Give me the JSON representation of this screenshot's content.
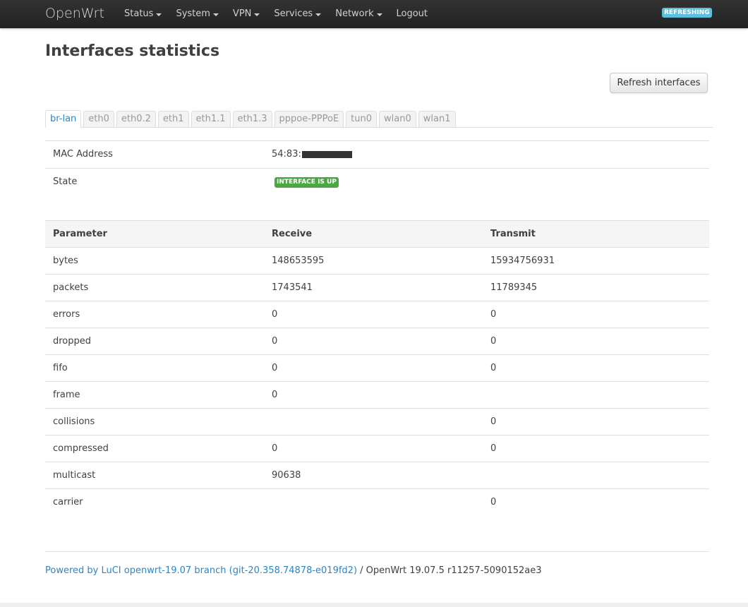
{
  "header": {
    "brand": "OpenWrt",
    "nav": [
      {
        "label": "Status",
        "dropdown": true
      },
      {
        "label": "System",
        "dropdown": true
      },
      {
        "label": "VPN",
        "dropdown": true
      },
      {
        "label": "Services",
        "dropdown": true
      },
      {
        "label": "Network",
        "dropdown": true
      },
      {
        "label": "Logout",
        "dropdown": false
      }
    ],
    "indicator": "REFRESHING"
  },
  "page": {
    "title": "Interfaces statistics",
    "refresh_button": "Refresh interfaces"
  },
  "tabs": [
    "br-lan",
    "eth0",
    "eth0.2",
    "eth1",
    "eth1.1",
    "eth1.3",
    "pppoe-PPPoE",
    "tun0",
    "wlan0",
    "wlan1"
  ],
  "active_tab": "br-lan",
  "info": {
    "mac_label": "MAC Address",
    "mac_value": "54:83:",
    "state_label": "State",
    "state_value": "INTERFACE IS UP"
  },
  "stats": {
    "headers": [
      "Parameter",
      "Receive",
      "Transmit"
    ],
    "rows": [
      [
        "bytes",
        "148653595",
        "15934756931"
      ],
      [
        "packets",
        "1743541",
        "11789345"
      ],
      [
        "errors",
        "0",
        "0"
      ],
      [
        "dropped",
        "0",
        "0"
      ],
      [
        "fifo",
        "0",
        "0"
      ],
      [
        "frame",
        "0",
        ""
      ],
      [
        "collisions",
        "",
        "0"
      ],
      [
        "compressed",
        "0",
        "0"
      ],
      [
        "multicast",
        "90638",
        ""
      ],
      [
        "carrier",
        "",
        "0"
      ]
    ]
  },
  "footer": {
    "link_text": "Powered by LuCI openwrt-19.07 branch (git-20.358.74878-e019fd2)",
    "suffix": " / OpenWrt 19.07.5 r11257-5090152ae3"
  },
  "colors": {
    "link": "#2c86c9",
    "badge_up": "#4aa842",
    "refreshing": "#5bc0de",
    "navbar": "#2a2a2a"
  }
}
